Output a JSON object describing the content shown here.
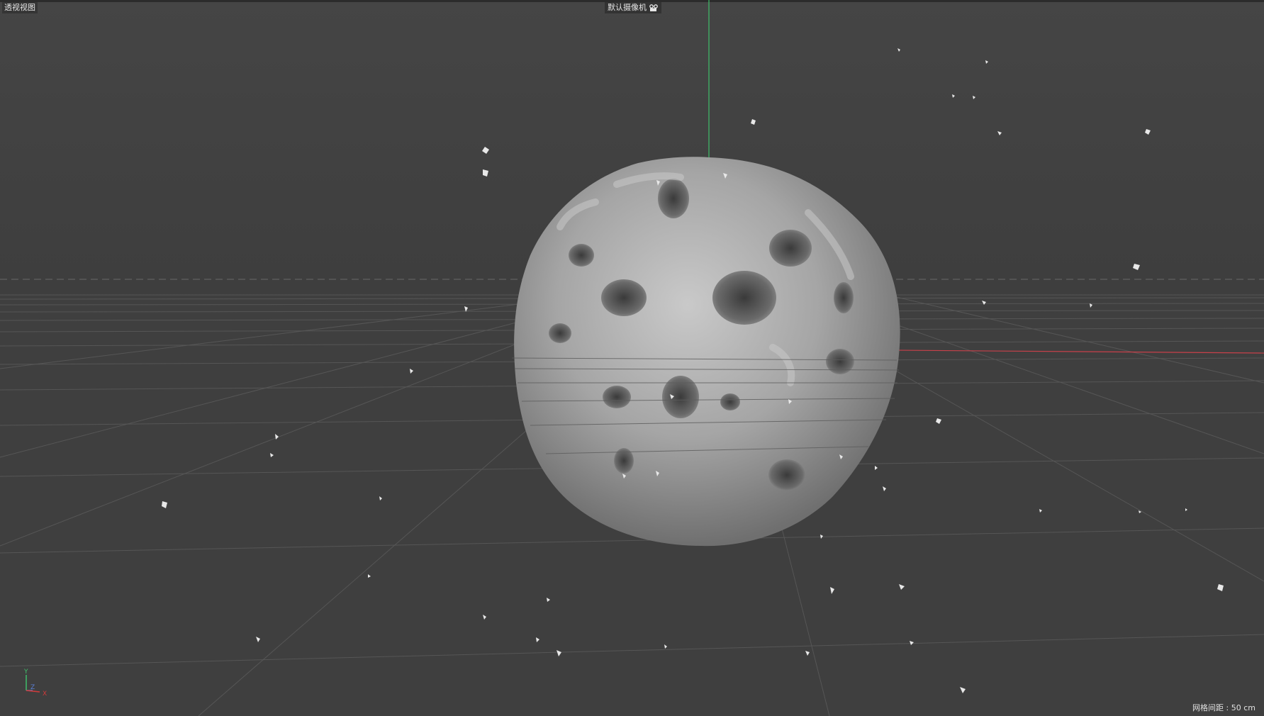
{
  "viewport": {
    "view_name": "透视视图",
    "camera_name": "默认摄像机",
    "grid_spacing": "网格间距 : 50 cm"
  },
  "axis_gizmo": {
    "y": "Y",
    "z": "Z",
    "x": "X"
  },
  "icons": {
    "camera": "camera-icon"
  },
  "colors": {
    "background": "#3d3d3d",
    "y_axis": "#3fbf6a",
    "x_axis": "#d23a3a",
    "object": "#a9a9a9"
  }
}
